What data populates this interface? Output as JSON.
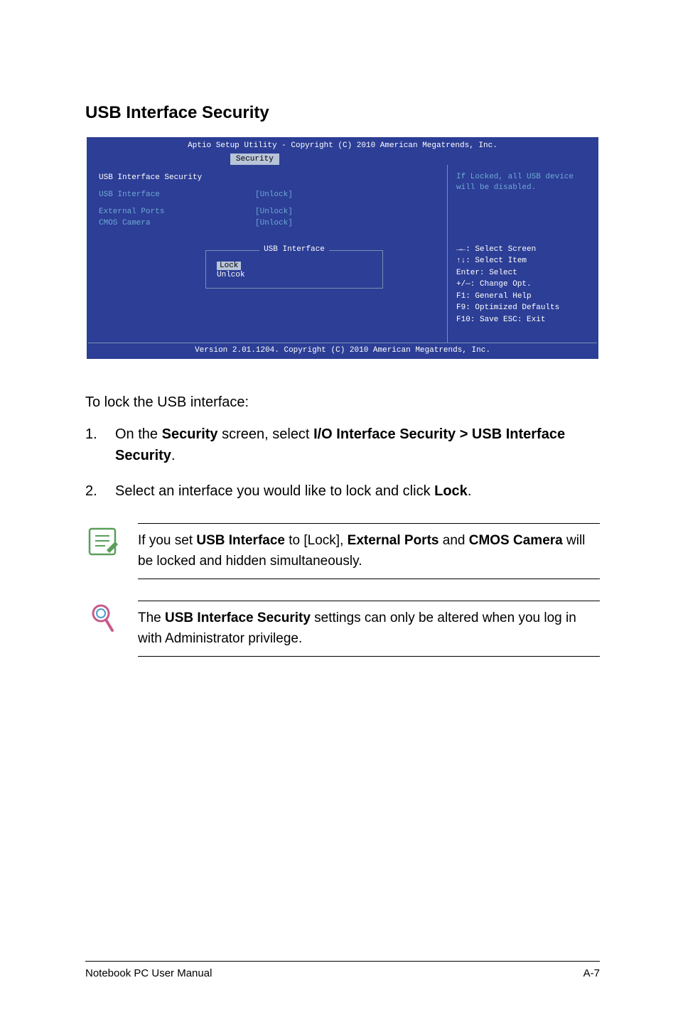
{
  "heading": "USB Interface Security",
  "bios": {
    "title": "Aptio Setup Utility - Copyright (C) 2010 American Megatrends, Inc.",
    "tab": "Security",
    "page_title": "USB Interface Security",
    "rows": [
      {
        "label": "USB Interface",
        "value": "[Unlock]"
      },
      {
        "label": "External Ports",
        "value": "[Unlock]"
      },
      {
        "label": "CMOS Camera",
        "value": "[Unlock]"
      }
    ],
    "popup": {
      "title": "USB Interface",
      "options": [
        "Lock",
        "Unlcok"
      ],
      "selected_index": 0
    },
    "help": "If Locked, all USB device will be disabled.",
    "nav": [
      "→←: Select Screen",
      "↑↓:   Select Item",
      "Enter: Select",
      "+/—:  Change Opt.",
      "F1:   General Help",
      "F9:   Optimized Defaults",
      "F10:  Save   ESC: Exit"
    ],
    "footer": "Version 2.01.1204. Copyright (C) 2010 American Megatrends, Inc."
  },
  "instructions": {
    "lead": "To lock the USB interface:",
    "items": [
      {
        "num": "1.",
        "pre": "On the ",
        "b1": "Security",
        "mid1": " screen, select ",
        "b2": "I/O Interface Security > USB Interface Security",
        "post": "."
      },
      {
        "num": "2.",
        "pre": "Select an interface you would like to lock and click ",
        "b1": "Lock",
        "post": "."
      }
    ]
  },
  "notes": [
    {
      "icon": "notepad",
      "segments": {
        "pre": "If you set ",
        "b1": "USB Interface",
        "mid1": " to [Lock], ",
        "b2": "External Ports",
        "mid2": " and ",
        "b3": "CMOS Camera",
        "post": " will be locked and hidden simultaneously."
      }
    },
    {
      "icon": "magnifier",
      "segments": {
        "pre": "The ",
        "b1": "USB Interface Security",
        "post": " settings can only be altered when you log in with Administrator privilege."
      }
    }
  ],
  "footer": {
    "left": "Notebook PC User Manual",
    "right": "A-7"
  }
}
